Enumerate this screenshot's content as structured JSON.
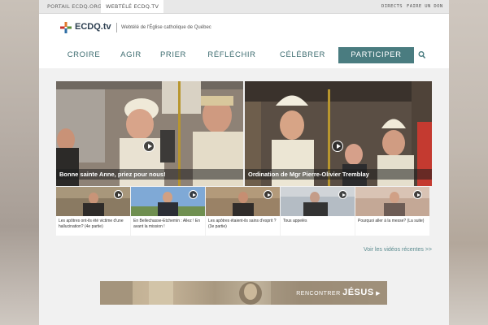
{
  "topbar": {
    "tabs": [
      {
        "label": "PORTAIL ECDQ.ORG",
        "active": false
      },
      {
        "label": "WEBTÉLÉ ECDQ.TV",
        "active": true
      }
    ],
    "links": [
      "DIRECTS",
      "FAIRE UN DON"
    ]
  },
  "header": {
    "logo_text": "ECDQ.tv",
    "tagline": "Webtélé de l'Église catholique de Québec"
  },
  "nav": {
    "items": [
      "CROIRE",
      "AGIR",
      "PRIER",
      "RÉFLÉCHIR",
      "CÉLÉBRER",
      "PARTICIPER"
    ],
    "active": "PARTICIPER",
    "accent": "#4a7c80"
  },
  "featured": [
    {
      "title": "Bonne sainte Anne, priez pour nous!"
    },
    {
      "title": "Ordination de Mgr Pierre-Olivier Tremblay"
    }
  ],
  "videos": [
    {
      "title": "Les apôtres ont-ils été victime d'une hallucination? (4e partie)"
    },
    {
      "title": "En Bellechasse-Etchemin : Allez ! En avant la mission !"
    },
    {
      "title": "Les apôtres étaient-ils sains d'esprit ? (3e partie)"
    },
    {
      "title": "Tous appelés"
    },
    {
      "title": "Pourquoi aller à la messe? (La suite)"
    }
  ],
  "more_link": "Voir les vidéos récentes >>",
  "banner": {
    "line1": "RENCONTRER",
    "line2": "JÉSUS",
    "arrow": "▶"
  }
}
